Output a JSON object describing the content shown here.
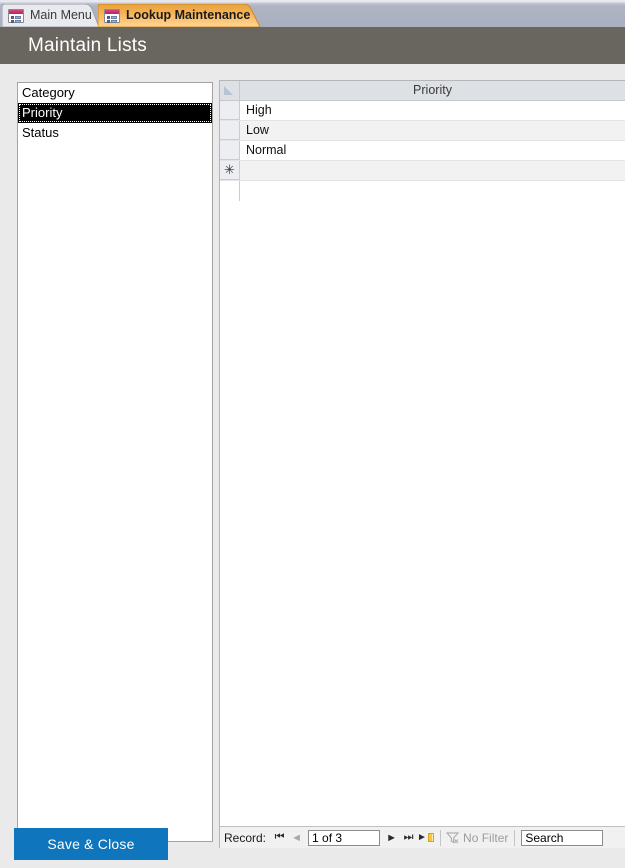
{
  "tabs": [
    {
      "label": "Main Menu",
      "icon": "form-icon",
      "active": false
    },
    {
      "label": "Lookup Maintenance",
      "icon": "form-icon",
      "active": true
    }
  ],
  "header": {
    "title": "Maintain Lists",
    "background": "#69665F"
  },
  "list_box": {
    "name": "lookup-list",
    "items": [
      {
        "label": "Category",
        "selected": false
      },
      {
        "label": "Priority",
        "selected": true
      },
      {
        "label": "Status",
        "selected": false
      }
    ]
  },
  "datasheet": {
    "column_header": "Priority",
    "rows": [
      {
        "value": "High"
      },
      {
        "value": "Low"
      },
      {
        "value": "Normal"
      }
    ],
    "new_record_marker": "✳"
  },
  "navigation": {
    "record_label": "Record:",
    "first_icon": "⏮",
    "previous_icon": "◄",
    "position": "1 of 3",
    "next_icon": "►",
    "last_icon": "⏭",
    "new_record_icon": "new-record-icon",
    "filter_icon": "funnel-icon",
    "filter_label": "No Filter",
    "search_value": "Search"
  },
  "footer": {
    "save_close_label": "Save & Close",
    "save_close_color": "#0F75BC"
  }
}
